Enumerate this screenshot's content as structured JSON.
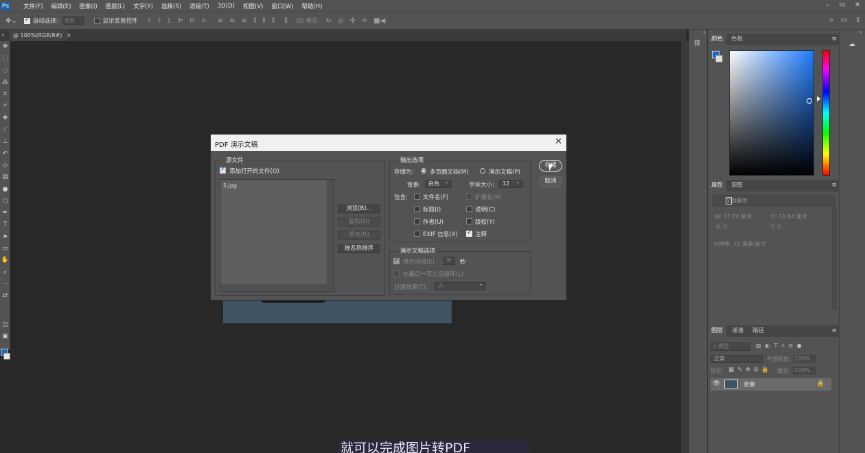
{
  "menubar": {
    "logo": "Ps",
    "items": [
      "文件(F)",
      "编辑(E)",
      "图像(I)",
      "图层(L)",
      "文字(Y)",
      "选择(S)",
      "滤镜(T)",
      "3D(D)",
      "视图(V)",
      "窗口(W)",
      "帮助(H)"
    ],
    "window_controls": [
      "–",
      "▭",
      "✕"
    ]
  },
  "options_bar": {
    "auto_select_label": "自动选择:",
    "auto_select_checked": true,
    "auto_select_target": "图层",
    "show_transform_label": "显示变换控件",
    "show_transform_checked": false,
    "mode_3d_label": "3D 模式:"
  },
  "document_tab": {
    "label": "@ 100%(RGB/8#)",
    "close": "×"
  },
  "subtitle": "就可以完成图片转PDF",
  "right_panel": {
    "color_tabs": [
      "颜色",
      "色板"
    ],
    "props_tabs": [
      "属性",
      "调整"
    ],
    "doc_props_title": "文档属性",
    "width": "W: 17.64 厘米",
    "height": "H: 11.84 厘米",
    "x": "X: 0",
    "y": "Y: 0",
    "resolution": "分辨率: 72 像素/英寸",
    "layers_tabs": [
      "图层",
      "通道",
      "路径"
    ],
    "layer_filter": "类型",
    "blend_mode": "正常",
    "opacity_label": "不透明度:",
    "opacity_value": "100%",
    "lock_label": "锁定:",
    "fill_label": "填充:",
    "fill_value": "100%",
    "layer_name": "背景"
  },
  "dialog": {
    "title": "PDF 演示文稿",
    "close": "✕",
    "source_group": "源文件",
    "add_open_files": "添加打开的文件(O)",
    "add_open_files_checked": true,
    "files": [
      "5.jpg"
    ],
    "btn_browse": "浏览(B)...",
    "btn_duplicate": "复制(D)",
    "btn_remove": "移去(R)",
    "btn_sort": "按名称排序",
    "output_group": "输出选项",
    "save_as_label": "存储为:",
    "save_multi": "多页面文档(M)",
    "save_presentation": "演示文稿(P)",
    "bg_label": "背景:",
    "bg_value": "白色",
    "font_size_label": "字体大小:",
    "font_size_value": "12",
    "include_label": "包含:",
    "inc_filename": "文件名(F)",
    "inc_extension": "扩展名(N)",
    "inc_title": "标题(I)",
    "inc_description": "说明(C)",
    "inc_author": "作者(U)",
    "inc_copyright": "版权(Y)",
    "inc_exif": "EXIF 信息(X)",
    "inc_annotation": "注释",
    "pres_group": "演示文稿选项",
    "advance_label": "换片间隔(E)",
    "advance_value": "5",
    "seconds": "秒",
    "loop_label": "在最后一页之后循环(L)",
    "transition_label": "过渡效果(T):",
    "transition_value": "无",
    "btn_save": "存储",
    "btn_cancel": "取消"
  },
  "colors": {
    "foreground": "#1c66c6",
    "background": "#e0e0e0",
    "panel": "#535353",
    "workspace": "#282828"
  }
}
